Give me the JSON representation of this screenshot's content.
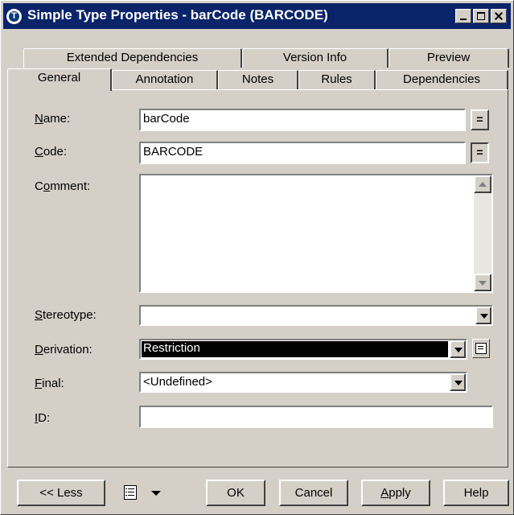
{
  "window": {
    "title": "Simple Type Properties - barCode (BARCODE)"
  },
  "tabs": {
    "row1": [
      "Extended Dependencies",
      "Version Info",
      "Preview"
    ],
    "row2": [
      "General",
      "Annotation",
      "Notes",
      "Rules",
      "Dependencies"
    ],
    "active": "General"
  },
  "form": {
    "name_label": "Name:",
    "name_value": "barCode",
    "code_label": "Code:",
    "code_value": "BARCODE",
    "comment_label": "Comment:",
    "comment_value": "",
    "stereotype_label": "Stereotype:",
    "stereotype_value": "",
    "derivation_label": "Derivation:",
    "derivation_value": "Restriction",
    "final_label": "Final:",
    "final_value": "<Undefined>",
    "id_label": "ID:",
    "id_value": "",
    "eq_symbol": "="
  },
  "buttons": {
    "less": "<< Less",
    "ok": "OK",
    "cancel": "Cancel",
    "apply": "Apply",
    "help": "Help"
  }
}
